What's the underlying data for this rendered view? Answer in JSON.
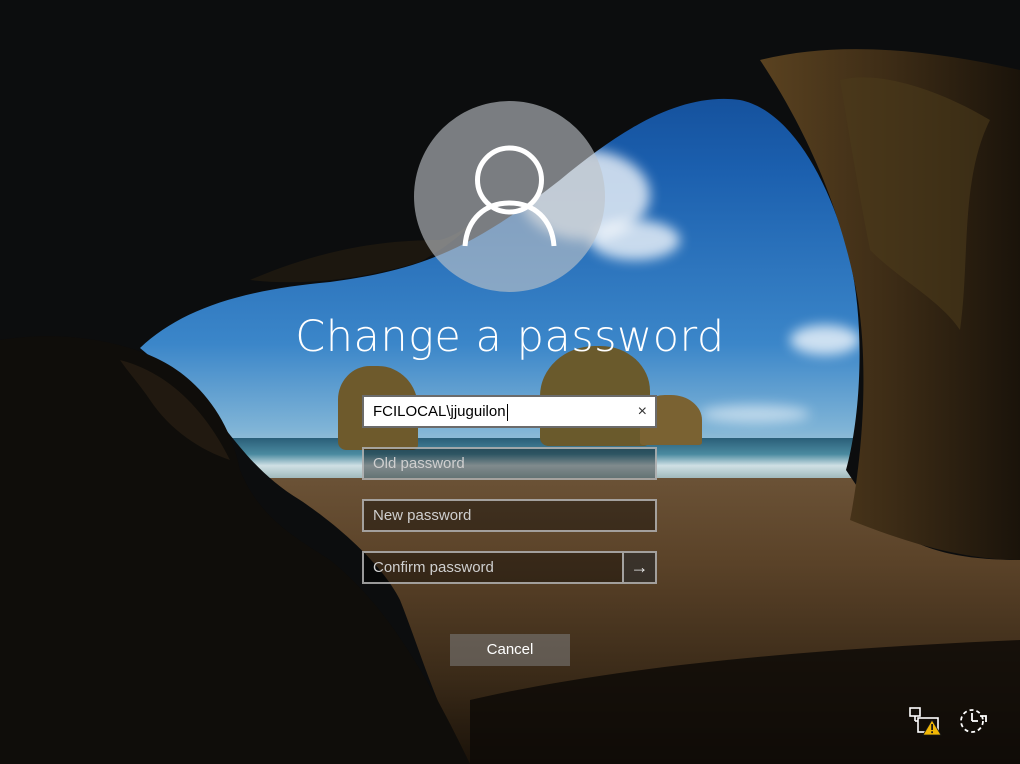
{
  "title": "Change a password",
  "fields": {
    "username_value": "FCILOCAL\\jjuguilon",
    "clear_symbol": "×",
    "old_password_placeholder": "Old password",
    "new_password_placeholder": "New password",
    "confirm_password_placeholder": "Confirm password",
    "submit_symbol": "→"
  },
  "buttons": {
    "cancel_label": "Cancel"
  },
  "tray": {
    "network_icon": "network-warning-icon",
    "accessibility_icon": "ease-of-access-icon"
  },
  "colors": {
    "text": "#ffffff",
    "active_field_bg": "#ffffff",
    "warning": "#f2b705"
  }
}
